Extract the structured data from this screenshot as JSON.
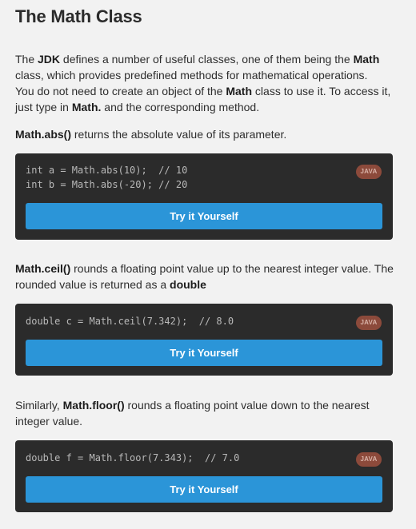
{
  "title": "The Math Class",
  "intro": {
    "s1_a": "The ",
    "s1_jdk": "JDK",
    "s1_b": " defines a number of useful classes, one of them being the ",
    "s1_math": "Math",
    "s1_c": " class, which provides predefined methods for mathematical operations.",
    "s2_a": "You do not need to create an object of the ",
    "s2_math": "Math",
    "s2_b": " class to use it. To access it, just type in ",
    "s2_mathdot": "Math.",
    "s2_c": " and the corresponding method."
  },
  "abs": {
    "method": "Math.abs()",
    "text": " returns the absolute value of its parameter.",
    "code": "int a = Math.abs(10);  // 10\nint b = Math.abs(-20); // 20",
    "badge": "JAVA",
    "button": "Try it Yourself"
  },
  "ceil": {
    "method": "Math.ceil()",
    "text": " rounds a floating point value up to the nearest integer value. The rounded value is returned as a ",
    "bold_end": "double",
    "code": "double c = Math.ceil(7.342);  // 8.0",
    "badge": "JAVA",
    "button": "Try it Yourself"
  },
  "floor": {
    "prefix": "Similarly, ",
    "method": "Math.floor()",
    "text": " rounds a floating point value down to the nearest integer value.",
    "code": "double f = Math.floor(7.343);  // 7.0",
    "badge": "JAVA",
    "button": "Try it Yourself"
  }
}
